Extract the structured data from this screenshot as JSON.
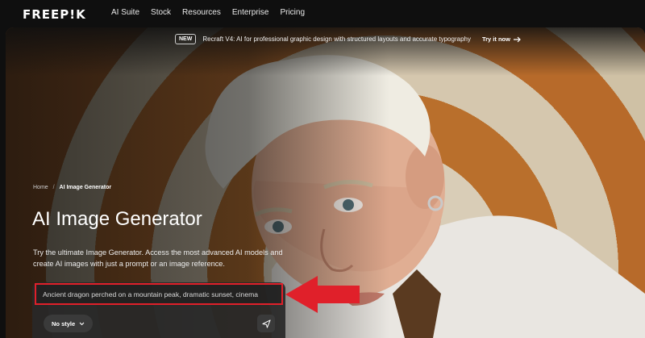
{
  "nav": {
    "logo": "FREEP!K",
    "links": [
      "AI Suite",
      "Stock",
      "Resources",
      "Enterprise",
      "Pricing"
    ]
  },
  "announcement": {
    "badge": "NEW",
    "text": "Recraft V4: AI for professional graphic design with structured layouts and accurate typography",
    "cta": "Try it now"
  },
  "breadcrumb": {
    "home": "Home",
    "separator": "/",
    "current": "AI Image Generator"
  },
  "hero": {
    "title": "AI Image Generator",
    "subtitle": "Try the ultimate Image Generator. Access the most advanced AI models and create AI images with just a prompt or an image reference."
  },
  "prompt": {
    "value": "Ancient dragon perched on a mountain peak, dramatic sunset, cinema",
    "style_label": "No style"
  },
  "colors": {
    "annotation_red": "#e0202a",
    "background": "#0f0f0f"
  },
  "icons": [
    "arrow-right-icon",
    "chevron-down-icon",
    "send-icon",
    "annotation-arrow-icon"
  ]
}
